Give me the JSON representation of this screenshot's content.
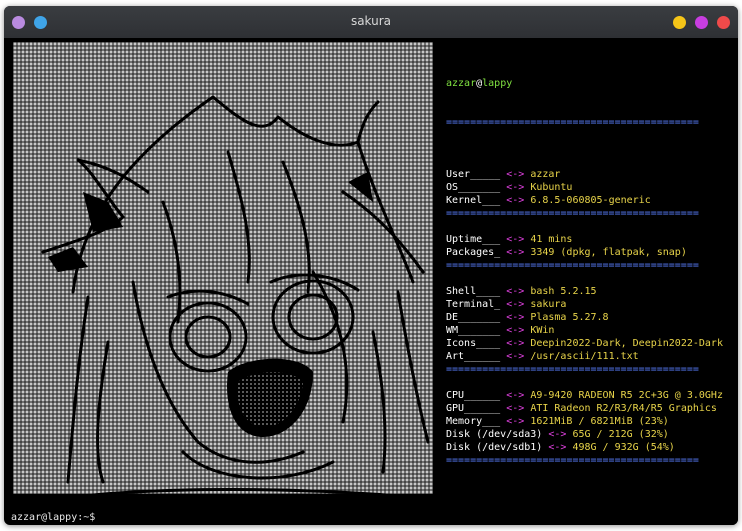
{
  "window": {
    "title": "sakura",
    "left_buttons": [
      {
        "name": "menu-orb-icon",
        "color": "#b98be0"
      },
      {
        "name": "circle-blue-icon",
        "color": "#3fa4e8"
      }
    ],
    "right_buttons": [
      {
        "name": "minimize-button",
        "color": "#f5c518"
      },
      {
        "name": "maximize-button",
        "color": "#c83ee0"
      },
      {
        "name": "close-button",
        "color": "#ef4a4a"
      }
    ]
  },
  "info": {
    "user": "azzar",
    "at": "@",
    "host": "lappy",
    "separator": "==========================================",
    "arrow": "<->",
    "groups": [
      [
        {
          "label": "User_____",
          "value": "azzar"
        },
        {
          "label": "OS_______",
          "value": "Kubuntu"
        },
        {
          "label": "Kernel___",
          "value": "6.8.5-060805-generic"
        }
      ],
      [
        {
          "label": "Uptime___",
          "value": "41 mins"
        },
        {
          "label": "Packages_",
          "value": "3349 (dpkg, flatpak, snap)"
        }
      ],
      [
        {
          "label": "Shell____",
          "value": "bash 5.2.15"
        },
        {
          "label": "Terminal_",
          "value": "sakura"
        },
        {
          "label": "DE_______",
          "value": "Plasma 5.27.8"
        },
        {
          "label": "WM_______",
          "value": "KWin"
        },
        {
          "label": "Icons____",
          "value": "Deepin2022-Dark, Deepin2022-Dark"
        },
        {
          "label": "Art______",
          "value": "/usr/ascii/111.txt"
        }
      ],
      [
        {
          "label": "CPU______",
          "value": "A9-9420 RADEON R5 2C+3G @ 3.0GHz"
        },
        {
          "label": "GPU______",
          "value": "ATI Radeon R2/R3/R4/R5 Graphics"
        },
        {
          "label": "Memory___",
          "value": "1621MiB / 6821MiB (23%)"
        },
        {
          "label": "Disk (/dev/sda3)",
          "value": "65G / 212G (32%)"
        },
        {
          "label": "Disk (/dev/sdb1)",
          "value": "498G / 932G (54%)"
        }
      ]
    ]
  },
  "prompt": {
    "text": "azzar@lappy:~$"
  },
  "colors": {
    "background": "#000000",
    "label": "#ffffff",
    "arrow": "#e040e0",
    "value": "#e8d44a",
    "username": "#7fe040",
    "separator": "#5a7fff",
    "art_background": "#c8c8c8"
  }
}
